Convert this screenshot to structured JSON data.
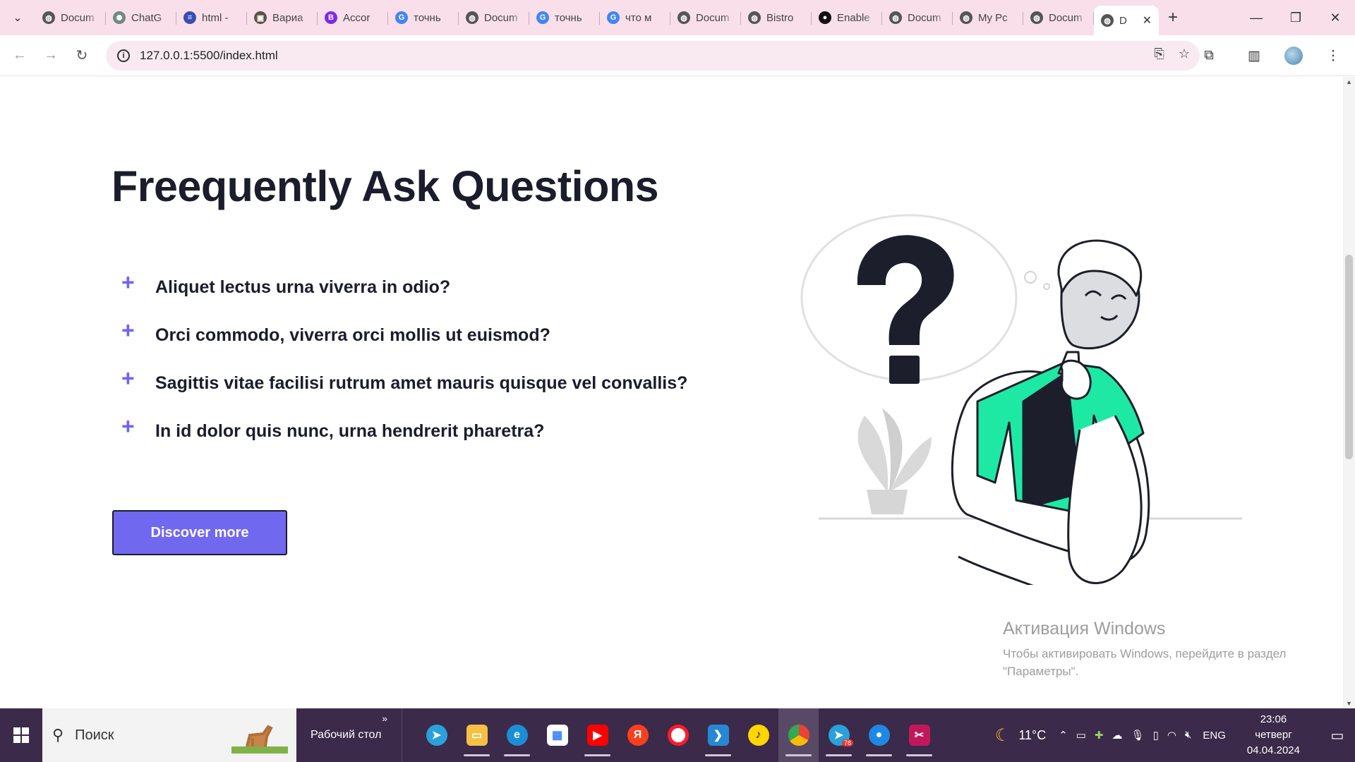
{
  "browser": {
    "tabs": [
      {
        "title": "Docum",
        "favicon": "globe-icon",
        "color": "#555"
      },
      {
        "title": "ChatG",
        "favicon": "chatgpt-icon",
        "color": "#6c8a7f"
      },
      {
        "title": "html -",
        "favicon": "stackoverflow-icon",
        "color": "#3a4db3"
      },
      {
        "title": "Вариа",
        "favicon": "film-icon",
        "color": "#5a5348"
      },
      {
        "title": "Accor",
        "favicon": "bootstrap-icon",
        "color": "#7c2ae8"
      },
      {
        "title": "точнь",
        "favicon": "google-icon",
        "color": "#4285f4"
      },
      {
        "title": "Docum",
        "favicon": "globe-icon",
        "color": "#555"
      },
      {
        "title": "точнь",
        "favicon": "google-icon",
        "color": "#4285f4"
      },
      {
        "title": "что м",
        "favicon": "google-icon",
        "color": "#4285f4"
      },
      {
        "title": "Docum",
        "favicon": "globe-icon",
        "color": "#555"
      },
      {
        "title": "Bistro",
        "favicon": "globe-icon",
        "color": "#555"
      },
      {
        "title": "Enable",
        "favicon": "github-icon",
        "color": "#111"
      },
      {
        "title": "Docum",
        "favicon": "globe-icon",
        "color": "#555"
      },
      {
        "title": "My Pc",
        "favicon": "globe-icon",
        "color": "#555"
      },
      {
        "title": "Docum",
        "favicon": "globe-icon",
        "color": "#555"
      }
    ],
    "active_tab": {
      "title": "D",
      "favicon": "globe-icon"
    },
    "url": "127.0.0.1:5500/index.html"
  },
  "faq": {
    "title": "Freequently Ask Questions",
    "questions": [
      "Aliquet lectus urna viverra in odio?",
      "Orci commodo, viverra orci mollis ut euismod?",
      "Sagittis vitae facilisi rutrum amet mauris quisque vel convallis?",
      "In id dolor quis nunc, urna hendrerit pharetra?"
    ],
    "cta_label": "Discover more",
    "accent_color": "#6c63ff"
  },
  "watermark": {
    "title": "Активация Windows",
    "line1": "Чтобы активировать Windows, перейдите в раздел",
    "line2": "\"Параметры\"."
  },
  "taskbar": {
    "search_placeholder": "Поиск",
    "desktop_label": "Рабочий стол",
    "weather": "11°C",
    "language": "ENG",
    "time": "23:06",
    "weekday": "четверг",
    "date": "04.04.2024",
    "telegram_badge": "78"
  }
}
